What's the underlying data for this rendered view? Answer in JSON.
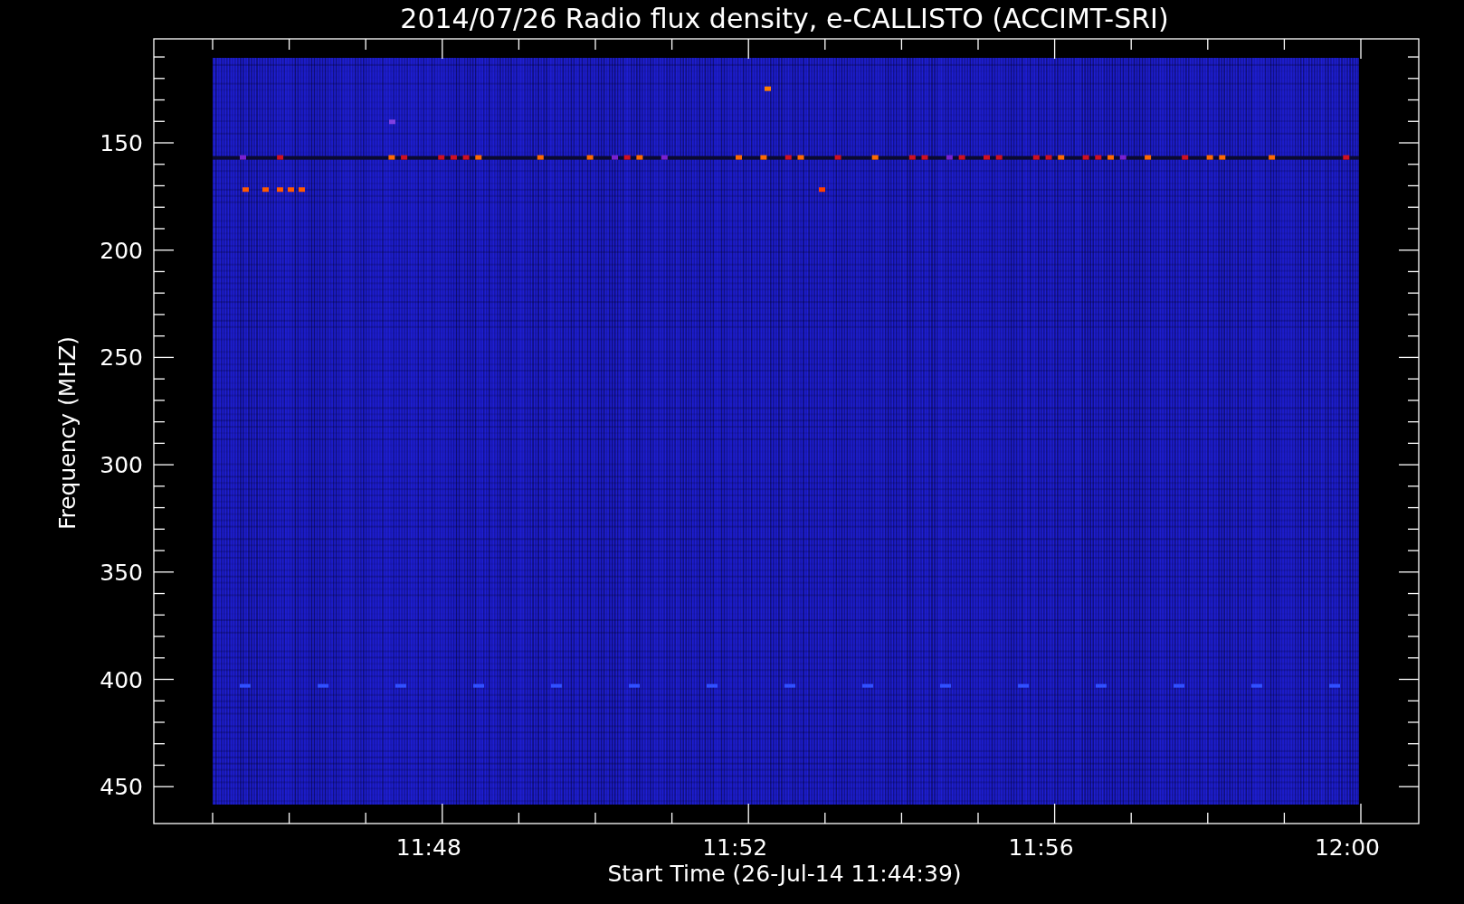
{
  "title": "2014/07/26  Radio flux density, e-CALLISTO (ACCIMT-SRI)",
  "y_axis": {
    "label": "Frequency (MHZ)",
    "ticks": [
      "150",
      "200",
      "250",
      "300",
      "350",
      "400",
      "450"
    ]
  },
  "x_axis": {
    "label": "Start Time (26-Jul-14 11:44:39)",
    "ticks": [
      "11:48",
      "11:52",
      "11:56",
      "12:00"
    ]
  }
}
